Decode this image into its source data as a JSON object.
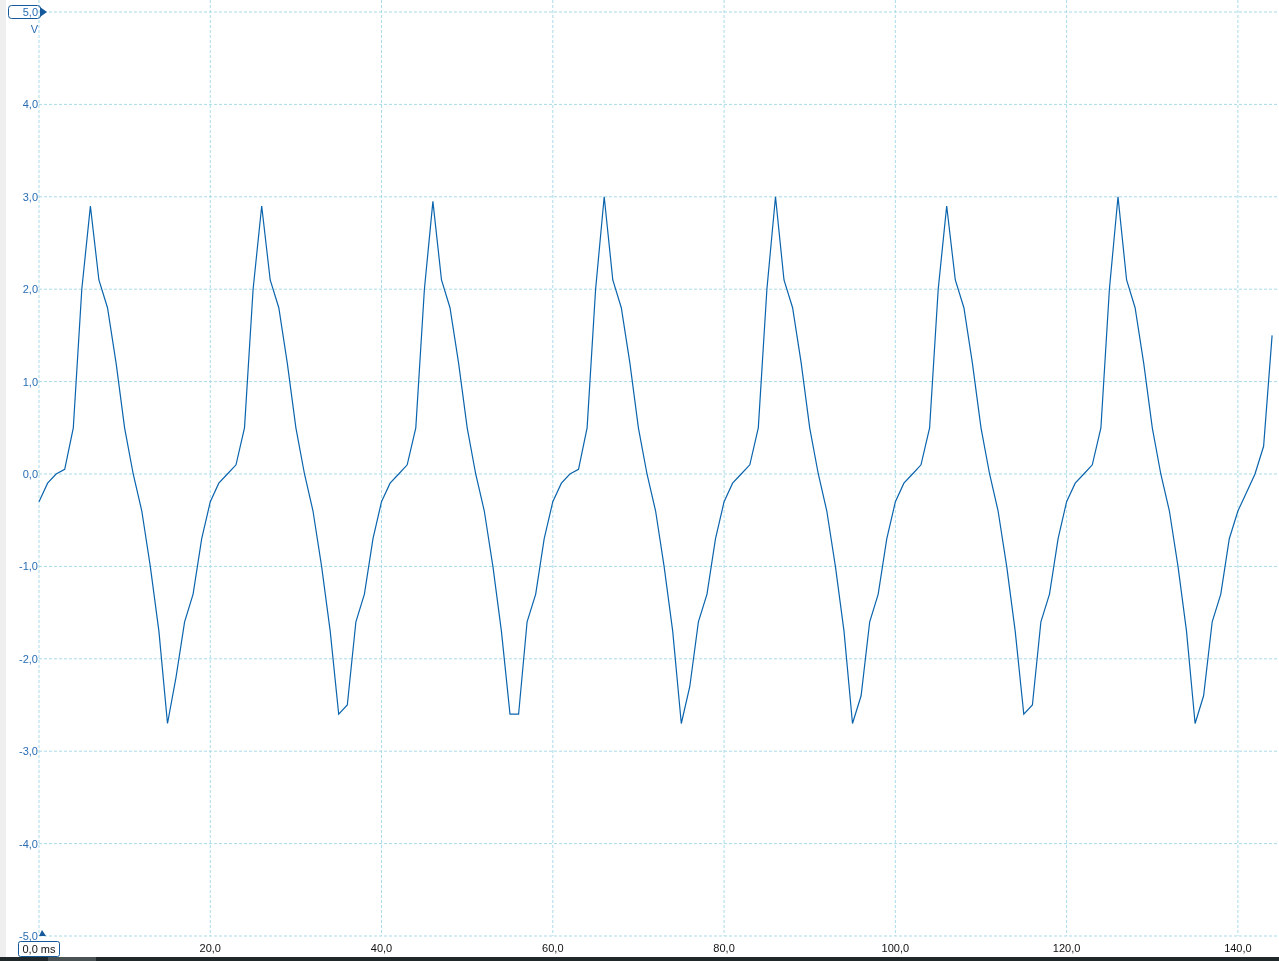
{
  "chart_data": {
    "type": "line",
    "ylabel": "V",
    "grid": true,
    "xlim": [
      0,
      144.8
    ],
    "ylim": [
      -5,
      5
    ],
    "xticks": [
      {
        "value": 0,
        "label": "0,0 ms"
      },
      {
        "value": 20,
        "label": "20,0"
      },
      {
        "value": 40,
        "label": "40,0"
      },
      {
        "value": 60,
        "label": "60,0"
      },
      {
        "value": 80,
        "label": "80,0"
      },
      {
        "value": 100,
        "label": "100,0"
      },
      {
        "value": 120,
        "label": "120,0"
      },
      {
        "value": 140,
        "label": "140,0"
      }
    ],
    "yticks": [
      {
        "value": 5,
        "label": "5,0"
      },
      {
        "value": 4,
        "label": "4,0"
      },
      {
        "value": 3,
        "label": "3,0"
      },
      {
        "value": 2,
        "label": "2,0"
      },
      {
        "value": 1,
        "label": "1,0"
      },
      {
        "value": 0,
        "label": "0,0"
      },
      {
        "value": -1,
        "label": "-1,0"
      },
      {
        "value": -2,
        "label": "-2,0"
      },
      {
        "value": -3,
        "label": "-3,0"
      },
      {
        "value": -4,
        "label": "-4,0"
      },
      {
        "value": -5,
        "label": "-5,0"
      }
    ],
    "x": [
      0,
      1,
      2,
      3,
      4,
      5,
      6,
      7,
      8,
      9,
      10,
      11,
      12,
      13,
      14,
      15,
      16,
      17,
      18,
      19,
      20,
      21,
      22,
      23,
      24,
      25,
      26,
      27,
      28,
      29,
      30,
      31,
      32,
      33,
      34,
      35,
      36,
      37,
      38,
      39,
      40,
      41,
      42,
      43,
      44,
      45,
      46,
      47,
      48,
      49,
      50,
      51,
      52,
      53,
      54,
      55,
      56,
      57,
      58,
      59,
      60,
      61,
      62,
      63,
      64,
      65,
      66,
      67,
      68,
      69,
      70,
      71,
      72,
      73,
      74,
      75,
      76,
      77,
      78,
      79,
      80,
      81,
      82,
      83,
      84,
      85,
      86,
      87,
      88,
      89,
      90,
      91,
      92,
      93,
      94,
      95,
      96,
      97,
      98,
      99,
      100,
      101,
      102,
      103,
      104,
      105,
      106,
      107,
      108,
      109,
      110,
      111,
      112,
      113,
      114,
      115,
      116,
      117,
      118,
      119,
      120,
      121,
      122,
      123,
      124,
      125,
      126,
      127,
      128,
      129,
      130,
      131,
      132,
      133,
      134,
      135,
      136,
      137,
      138,
      139,
      140,
      141,
      142,
      143,
      144
    ],
    "series": [
      {
        "color": "#0a64ad",
        "values": [
          -0.3,
          -0.1,
          0.0,
          0.05,
          0.5,
          2.0,
          2.9,
          2.1,
          1.8,
          1.2,
          0.5,
          0.0,
          -0.4,
          -1.0,
          -1.7,
          -2.7,
          -2.2,
          -1.6,
          -1.3,
          -0.7,
          -0.3,
          -0.1,
          0.0,
          0.1,
          0.5,
          2.0,
          2.9,
          2.1,
          1.8,
          1.2,
          0.5,
          0.0,
          -0.4,
          -1.0,
          -1.7,
          -2.6,
          -2.5,
          -1.6,
          -1.3,
          -0.7,
          -0.3,
          -0.1,
          0.0,
          0.1,
          0.5,
          2.0,
          2.95,
          2.1,
          1.8,
          1.2,
          0.5,
          0.0,
          -0.4,
          -1.0,
          -1.7,
          -2.6,
          -2.6,
          -1.6,
          -1.3,
          -0.7,
          -0.3,
          -0.1,
          0.0,
          0.05,
          0.5,
          2.0,
          3.0,
          2.1,
          1.8,
          1.2,
          0.5,
          0.0,
          -0.4,
          -1.0,
          -1.7,
          -2.7,
          -2.3,
          -1.6,
          -1.3,
          -0.7,
          -0.3,
          -0.1,
          0.0,
          0.1,
          0.5,
          2.0,
          3.0,
          2.1,
          1.8,
          1.2,
          0.5,
          0.0,
          -0.4,
          -1.0,
          -1.7,
          -2.7,
          -2.4,
          -1.6,
          -1.3,
          -0.7,
          -0.3,
          -0.1,
          0.0,
          0.1,
          0.5,
          2.0,
          2.9,
          2.1,
          1.8,
          1.2,
          0.5,
          0.0,
          -0.4,
          -1.0,
          -1.7,
          -2.6,
          -2.5,
          -1.6,
          -1.3,
          -0.7,
          -0.3,
          -0.1,
          0.0,
          0.1,
          0.5,
          2.0,
          3.0,
          2.1,
          1.8,
          1.2,
          0.5,
          0.0,
          -0.4,
          -1.0,
          -1.7,
          -2.7,
          -2.4,
          -1.6,
          -1.3,
          -0.7,
          -0.4,
          -0.2,
          0.0,
          0.3,
          1.5
        ]
      }
    ]
  }
}
